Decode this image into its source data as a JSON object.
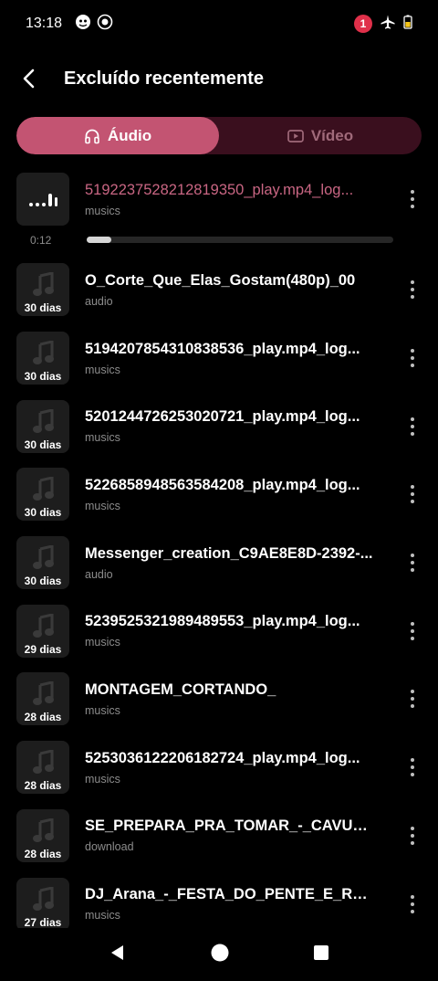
{
  "status_bar": {
    "time": "13:18",
    "notification_count": "1"
  },
  "header": {
    "title": "Excluído recentemente"
  },
  "tabs": [
    {
      "label": "Áudio",
      "active": true
    },
    {
      "label": "Vídeo",
      "active": false
    }
  ],
  "playing": {
    "name": "5192237528212819350_play.mp4_log...",
    "folder": "musics",
    "elapsed": "0:12",
    "progress": 0.08
  },
  "items": [
    {
      "name": "O_Corte_Que_Elas_Gostam(480p)_00",
      "folder": "audio",
      "days": "30 dias"
    },
    {
      "name": "5194207854310838536_play.mp4_log...",
      "folder": "musics",
      "days": "30 dias"
    },
    {
      "name": "5201244726253020721_play.mp4_log...",
      "folder": "musics",
      "days": "30 dias"
    },
    {
      "name": "5226858948563584208_play.mp4_log...",
      "folder": "musics",
      "days": "30 dias"
    },
    {
      "name": "Messenger_creation_C9AE8E8D-2392-...",
      "folder": "audio",
      "days": "30 dias"
    },
    {
      "name": "5239525321989489553_play.mp4_log...",
      "folder": "musics",
      "days": "29 dias"
    },
    {
      "name": "MONTAGEM_CORTANDO_",
      "folder": "musics",
      "days": "28 dias"
    },
    {
      "name": "5253036122206182724_play.mp4_log...",
      "folder": "musics",
      "days": "28 dias"
    },
    {
      "name": "SE_PREPARA_PRA_TOMAR_-_CAVUCA...",
      "folder": "download",
      "days": "28 dias"
    },
    {
      "name": "DJ_Arana_-_FESTA_DO_PENTE_E_RALA...",
      "folder": "musics",
      "days": "27 dias"
    }
  ],
  "colors": {
    "accent": "#c35472",
    "playing_text": "#c96683",
    "tab_track": "#3a0f1e"
  }
}
